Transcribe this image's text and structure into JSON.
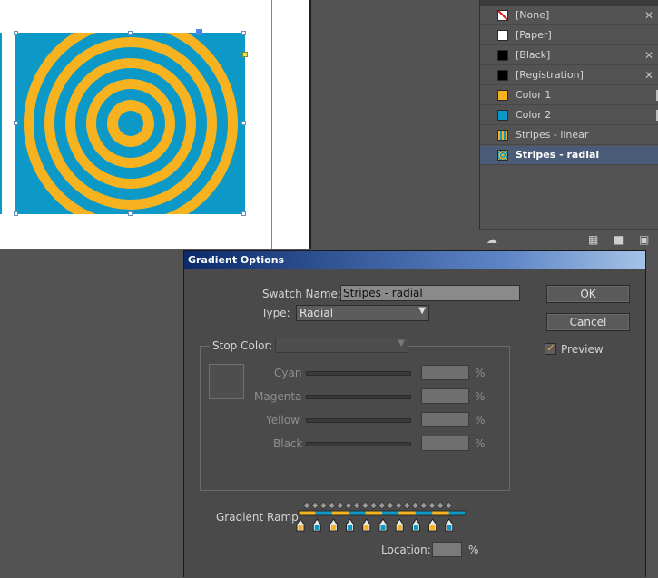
{
  "swatches": {
    "items": [
      {
        "label": "[None]",
        "color": "none",
        "noedit": true
      },
      {
        "label": "[Paper]",
        "color": "#ffffff",
        "noedit": false
      },
      {
        "label": "[Black]",
        "color": "#000000",
        "noedit": true
      },
      {
        "label": "[Registration]",
        "color": "#000000",
        "noedit": true
      },
      {
        "label": "Color 1",
        "color": "#f7b21f",
        "noedit": false
      },
      {
        "label": "Color 2",
        "color": "#0c99c7",
        "noedit": false
      },
      {
        "label": "Stripes - linear",
        "color": "stripes",
        "noedit": false
      },
      {
        "label": "Stripes - radial",
        "color": "radial",
        "noedit": false,
        "selected": true
      }
    ],
    "footer_icons": [
      "cloud-icon",
      "view-options-icon",
      "new-folder-icon",
      "new-swatch-icon"
    ]
  },
  "colors": {
    "yellow": "#f7b21f",
    "blue": "#0c99c7"
  },
  "dialog": {
    "title": "Gradient Options",
    "swatch_name_label": "Swatch Name:",
    "swatch_name_value": "Stripes - radial",
    "type_label": "Type:",
    "type_value": "Radial",
    "stop_color_label": "Stop Color:",
    "cyan_label": "Cyan",
    "magenta_label": "Magenta",
    "yellow_label": "Yellow",
    "black_label": "Black",
    "percent": "%",
    "ramp_label": "Gradient Ramp",
    "location_label": "Location:",
    "location_percent": "%",
    "ok_label": "OK",
    "cancel_label": "Cancel",
    "preview_label": "Preview",
    "preview_checked": true
  }
}
